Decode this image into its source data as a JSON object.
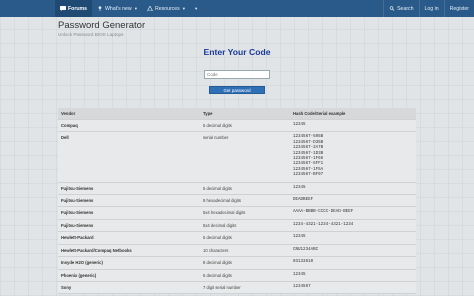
{
  "navbar": {
    "items": [
      {
        "label": "Forums",
        "icon": "forum-icon"
      },
      {
        "label": "What's new",
        "icon": "pin-icon"
      },
      {
        "label": "Resources",
        "icon": "resources-icon"
      }
    ],
    "search_label": "Search",
    "login_label": "Log in",
    "register_label": "Register"
  },
  "page": {
    "title": "Password Generator",
    "subtitle": "Unlock Password BIOS Laptops"
  },
  "form": {
    "heading": "Enter Your Code",
    "input_placeholder": "Code",
    "button_label": "Get password"
  },
  "table": {
    "headers": [
      "Vendor",
      "Type",
      "Hash Code/Serial example"
    ],
    "rows": [
      {
        "vendor": "Compaq",
        "type": "5 decimal digits",
        "hash": [
          "12345"
        ]
      },
      {
        "vendor": "Dell",
        "type": "serial number",
        "hash": [
          "1234567-595B",
          "1234567-D35B",
          "1234567-2A7B",
          "1234567-1D3B",
          "1234567-1F66",
          "1234567-6FF1",
          "1234567-1F5A",
          "1234567-BF97"
        ]
      },
      {
        "vendor": "Fujitsu-Siemens",
        "type": "5 decimal digits",
        "hash": [
          "12345"
        ]
      },
      {
        "vendor": "Fujitsu-Siemens",
        "type": "8 hexadecimal digits",
        "hash": [
          "DEADBEEF"
        ]
      },
      {
        "vendor": "Fujitsu-Siemens",
        "type": "5x4 hexadecimal digits",
        "hash": [
          "AAAA-BBBB-CCCC-DEAD-BEEF"
        ]
      },
      {
        "vendor": "Fujitsu-Siemens",
        "type": "5x4 decimal digits",
        "hash": [
          "1234-4321-1234-4321-1234"
        ]
      },
      {
        "vendor": "Hewlett-Packard",
        "type": "5 decimal digits",
        "hash": [
          "12345"
        ]
      },
      {
        "vendor": "Hewlett-Packard/Compaq Netbooks",
        "type": "10 characters",
        "hash": [
          "CNU1234ABC"
        ]
      },
      {
        "vendor": "Insyde H2O (generic)",
        "type": "8 decimal digits",
        "hash": [
          "03133610"
        ]
      },
      {
        "vendor": "Phoenix (generic)",
        "type": "5 decimal digits",
        "hash": [
          "12345"
        ]
      },
      {
        "vendor": "Sony",
        "type": "7 digit serial number",
        "hash": [
          "1234567"
        ]
      }
    ]
  },
  "colors": {
    "navbar": "#2a5a8a",
    "heading": "#1a3a9a",
    "button": "#2f6fb5"
  }
}
